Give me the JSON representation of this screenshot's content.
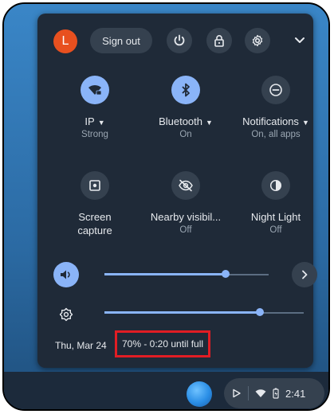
{
  "header": {
    "avatar_letter": "L",
    "sign_out_label": "Sign out"
  },
  "tiles": [
    {
      "label": "IP",
      "sub": "Strong",
      "icon": "wifi-lock-icon",
      "active": true,
      "has_menu": true
    },
    {
      "label": "Bluetooth",
      "sub": "On",
      "icon": "bluetooth-icon",
      "active": true,
      "has_menu": true
    },
    {
      "label": "Notifications",
      "sub": "On, all apps",
      "icon": "do-not-disturb-icon",
      "active": false,
      "has_menu": true
    },
    {
      "label_line1": "Screen",
      "label_line2": "capture",
      "icon": "screen-capture-icon",
      "active": false
    },
    {
      "label": "Nearby visibil...",
      "sub": "Off",
      "icon": "visibility-off-icon",
      "active": false
    },
    {
      "label": "Night Light",
      "sub": "Off",
      "icon": "night-light-icon",
      "active": false
    }
  ],
  "sliders": {
    "volume_level": 0.74,
    "brightness_level": 0.78
  },
  "footer": {
    "date": "Thu, Mar 24",
    "battery_status": "70% - 0:20 until full"
  },
  "shelf": {
    "time": "2:41"
  },
  "colors": {
    "panel_bg": "#1f2a38",
    "accent": "#8ab4f8",
    "avatar": "#e8501f",
    "highlight_box": "#e11d24"
  }
}
